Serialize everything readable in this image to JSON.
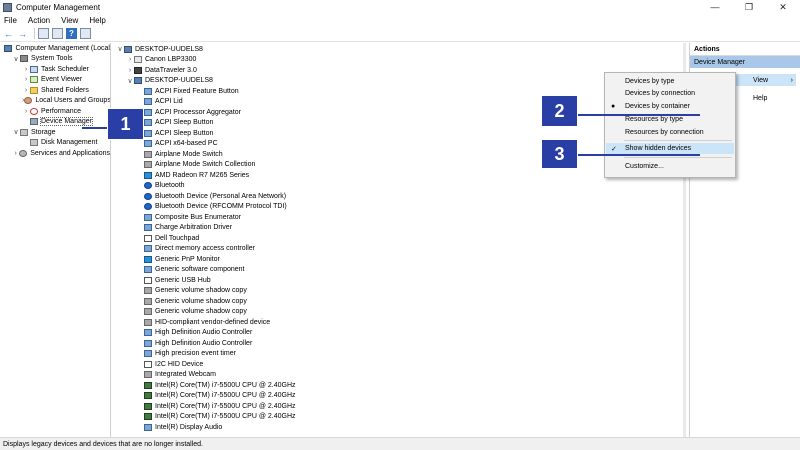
{
  "window": {
    "title": "Computer Management",
    "controls": [
      "—",
      "❐",
      "✕"
    ]
  },
  "menubar": [
    "File",
    "Action",
    "View",
    "Help"
  ],
  "toolbar": {
    "buttons": [
      "back-arrow",
      "forward-arrow",
      "folder",
      "properties",
      "help",
      "show-hide-tree"
    ]
  },
  "left_tree": [
    {
      "label": "Computer Management (Local",
      "indent": 0,
      "expander": "",
      "icon": "comp"
    },
    {
      "label": "System Tools",
      "indent": 1,
      "expander": "∨",
      "icon": "tool"
    },
    {
      "label": "Task Scheduler",
      "indent": 2,
      "expander": "›",
      "icon": "sched"
    },
    {
      "label": "Event Viewer",
      "indent": 2,
      "expander": "›",
      "icon": "event"
    },
    {
      "label": "Shared Folders",
      "indent": 2,
      "expander": "›",
      "icon": "folder"
    },
    {
      "label": "Local Users and Groups",
      "indent": 2,
      "expander": "›",
      "icon": "users"
    },
    {
      "label": "Performance",
      "indent": 2,
      "expander": "›",
      "icon": "perf"
    },
    {
      "label": "Device Manager",
      "indent": 2,
      "expander": "",
      "icon": "dm",
      "selected": true
    },
    {
      "label": "Storage",
      "indent": 1,
      "expander": "∨",
      "icon": "disk"
    },
    {
      "label": "Disk Management",
      "indent": 2,
      "expander": "",
      "icon": "disk"
    },
    {
      "label": "Services and Applications",
      "indent": 1,
      "expander": "›",
      "icon": "svc"
    }
  ],
  "device_tree": [
    {
      "label": "DESKTOP-UUDELS8",
      "indent": 0,
      "expander": "∨",
      "icon": "comp"
    },
    {
      "label": "Canon LBP3300",
      "indent": 1,
      "expander": "›",
      "icon": "printer"
    },
    {
      "label": "DataTraveler 3.0",
      "indent": 1,
      "expander": "›",
      "icon": "usb"
    },
    {
      "label": "DESKTOP-UUDELS8",
      "indent": 1,
      "expander": "∨",
      "icon": "comp"
    },
    {
      "label": "ACPI Fixed Feature Button",
      "indent": 2,
      "expander": "",
      "icon": "dev"
    },
    {
      "label": "ACPI Lid",
      "indent": 2,
      "expander": "",
      "icon": "dev"
    },
    {
      "label": "ACPI Processor Aggregator",
      "indent": 2,
      "expander": "",
      "icon": "dev"
    },
    {
      "label": "ACPI Sleep Button",
      "indent": 2,
      "expander": "",
      "icon": "dev"
    },
    {
      "label": "ACPI Sleep Button",
      "indent": 2,
      "expander": "",
      "icon": "dev"
    },
    {
      "label": "ACPI x64-based PC",
      "indent": 2,
      "expander": "",
      "icon": "dev"
    },
    {
      "label": "Airplane Mode Switch",
      "indent": 2,
      "expander": "",
      "icon": "dev-gray"
    },
    {
      "label": "Airplane Mode Switch Collection",
      "indent": 2,
      "expander": "",
      "icon": "dev-gray"
    },
    {
      "label": "AMD Radeon R7 M265 Series",
      "indent": 2,
      "expander": "",
      "icon": "dev-mon"
    },
    {
      "label": "Bluetooth",
      "indent": 2,
      "expander": "",
      "icon": "dev-bt"
    },
    {
      "label": "Bluetooth Device (Personal Area Network)",
      "indent": 2,
      "expander": "",
      "icon": "dev-bt"
    },
    {
      "label": "Bluetooth Device (RFCOMM Protocol TDI)",
      "indent": 2,
      "expander": "",
      "icon": "dev-bt"
    },
    {
      "label": "Composite Bus Enumerator",
      "indent": 2,
      "expander": "",
      "icon": "dev"
    },
    {
      "label": "Charge Arbitration Driver",
      "indent": 2,
      "expander": "",
      "icon": "dev"
    },
    {
      "label": "Dell Touchpad",
      "indent": 2,
      "expander": "",
      "icon": "dev-plain"
    },
    {
      "label": "Direct memory access controller",
      "indent": 2,
      "expander": "",
      "icon": "dev"
    },
    {
      "label": "Generic PnP Monitor",
      "indent": 2,
      "expander": "",
      "icon": "dev-mon"
    },
    {
      "label": "Generic software component",
      "indent": 2,
      "expander": "",
      "icon": "dev"
    },
    {
      "label": "Generic USB Hub",
      "indent": 2,
      "expander": "",
      "icon": "dev-plain"
    },
    {
      "label": "Generic volume shadow copy",
      "indent": 2,
      "expander": "",
      "icon": "dev-gray"
    },
    {
      "label": "Generic volume shadow copy",
      "indent": 2,
      "expander": "",
      "icon": "dev-gray"
    },
    {
      "label": "Generic volume shadow copy",
      "indent": 2,
      "expander": "",
      "icon": "dev-gray"
    },
    {
      "label": "HID-compliant vendor-defined device",
      "indent": 2,
      "expander": "",
      "icon": "dev-gray"
    },
    {
      "label": "High Definition Audio Controller",
      "indent": 2,
      "expander": "",
      "icon": "dev"
    },
    {
      "label": "High Definition Audio Controller",
      "indent": 2,
      "expander": "",
      "icon": "dev"
    },
    {
      "label": "High precision event timer",
      "indent": 2,
      "expander": "",
      "icon": "dev"
    },
    {
      "label": "I2C HID Device",
      "indent": 2,
      "expander": "",
      "icon": "dev-plain"
    },
    {
      "label": "Integrated Webcam",
      "indent": 2,
      "expander": "",
      "icon": "dev-gray"
    },
    {
      "label": "Intel(R) Core(TM) i7-5500U CPU @ 2.40GHz",
      "indent": 2,
      "expander": "",
      "icon": "dev-chip"
    },
    {
      "label": "Intel(R) Core(TM) i7-5500U CPU @ 2.40GHz",
      "indent": 2,
      "expander": "",
      "icon": "dev-chip"
    },
    {
      "label": "Intel(R) Core(TM) i7-5500U CPU @ 2.40GHz",
      "indent": 2,
      "expander": "",
      "icon": "dev-chip"
    },
    {
      "label": "Intel(R) Core(TM) i7-5500U CPU @ 2.40GHz",
      "indent": 2,
      "expander": "",
      "icon": "dev-chip"
    },
    {
      "label": "Intel(R) Display Audio",
      "indent": 2,
      "expander": "",
      "icon": "dev"
    }
  ],
  "actions": {
    "header": "Actions",
    "section": "Device Manager",
    "section_arrow": "▲"
  },
  "context_menu": {
    "view_label": "View",
    "view_arrow": "›",
    "help_label": "Help"
  },
  "view_submenu": {
    "items": [
      {
        "label": "Devices by type",
        "mark": ""
      },
      {
        "label": "Devices by connection",
        "mark": ""
      },
      {
        "label": "Devices by container",
        "mark": "●"
      },
      {
        "label": "Resources by type",
        "mark": ""
      },
      {
        "label": "Resources by connection",
        "mark": ""
      },
      {
        "label": "Show hidden devices",
        "mark": "✓",
        "highlighted": true
      },
      {
        "label": "Customize...",
        "mark": ""
      }
    ]
  },
  "callouts": [
    "1",
    "2",
    "3"
  ],
  "status_text": "Displays legacy devices and devices that are no longer installed.",
  "colors": {
    "callout": "#2a3fa6",
    "highlight": "#cce4f7",
    "actions_section": "#a9c7e8"
  }
}
